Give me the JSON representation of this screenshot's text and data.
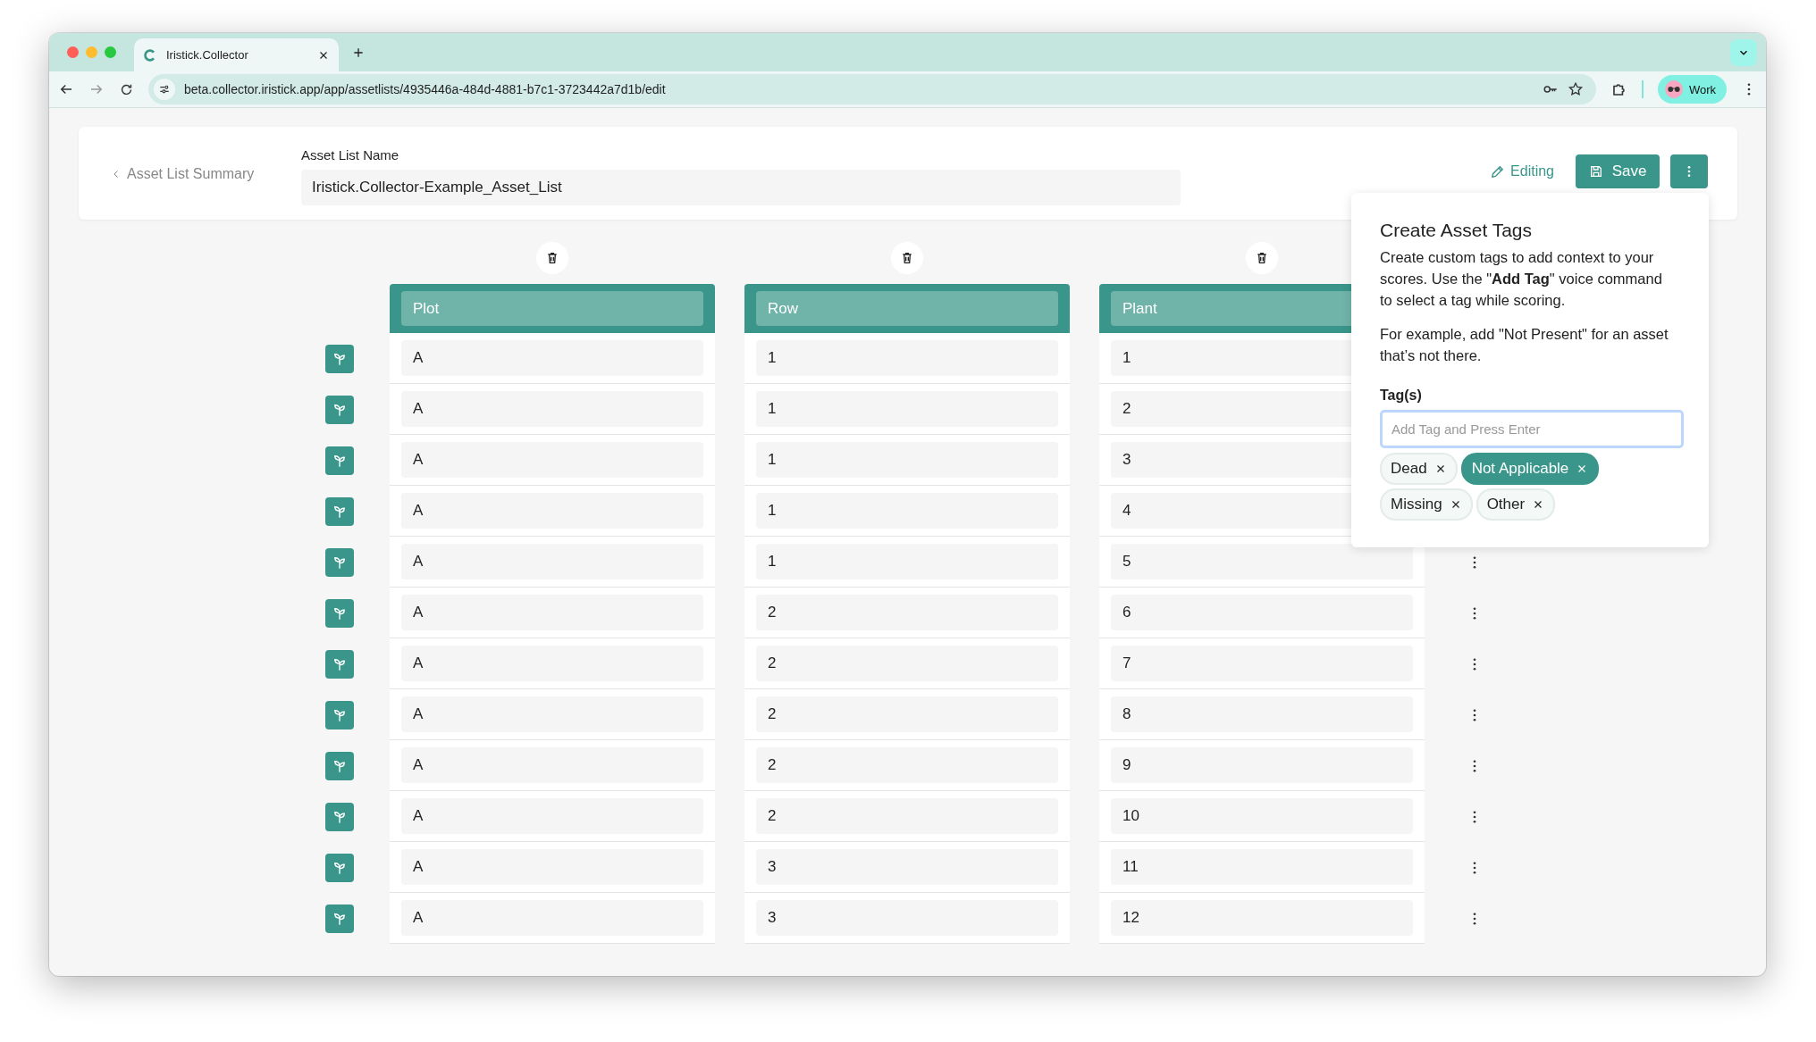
{
  "browser": {
    "tab": {
      "title": "Iristick.Collector"
    },
    "url": "beta.collector.iristick.app/app/assetlists/4935446a-484d-4881-b7c1-3723442a7d1b/edit",
    "profile": "Work"
  },
  "header": {
    "back_link": "Asset List Summary",
    "name_label": "Asset List Name",
    "name_value": "Iristick.Collector-Example_Asset_List",
    "status": "Editing",
    "save": "Save"
  },
  "table": {
    "columns": [
      "Plot",
      "Row",
      "Plant"
    ],
    "rows": [
      {
        "cells": [
          "A",
          "1",
          "1"
        ]
      },
      {
        "cells": [
          "A",
          "1",
          "2"
        ]
      },
      {
        "cells": [
          "A",
          "1",
          "3"
        ]
      },
      {
        "cells": [
          "A",
          "1",
          "4"
        ]
      },
      {
        "cells": [
          "A",
          "1",
          "5"
        ]
      },
      {
        "cells": [
          "A",
          "2",
          "6"
        ]
      },
      {
        "cells": [
          "A",
          "2",
          "7"
        ]
      },
      {
        "cells": [
          "A",
          "2",
          "8"
        ]
      },
      {
        "cells": [
          "A",
          "2",
          "9"
        ]
      },
      {
        "cells": [
          "A",
          "2",
          "10"
        ]
      },
      {
        "cells": [
          "A",
          "3",
          "11"
        ]
      },
      {
        "cells": [
          "A",
          "3",
          "12"
        ]
      }
    ]
  },
  "popup": {
    "title": "Create Asset Tags",
    "paragraphs": [
      "Create custom tags to add context to your scores. Use the \"**Add Tag**\" voice command to select a tag while scoring.",
      "For example, add \"Not Present\" for an asset that’s not there."
    ],
    "tags_label": "Tag(s)",
    "placeholder": "Add Tag and Press Enter",
    "tags": [
      {
        "label": "Dead",
        "selected": false
      },
      {
        "label": "Not Applicable",
        "selected": true
      },
      {
        "label": "Missing",
        "selected": false
      },
      {
        "label": "Other",
        "selected": false
      }
    ]
  }
}
